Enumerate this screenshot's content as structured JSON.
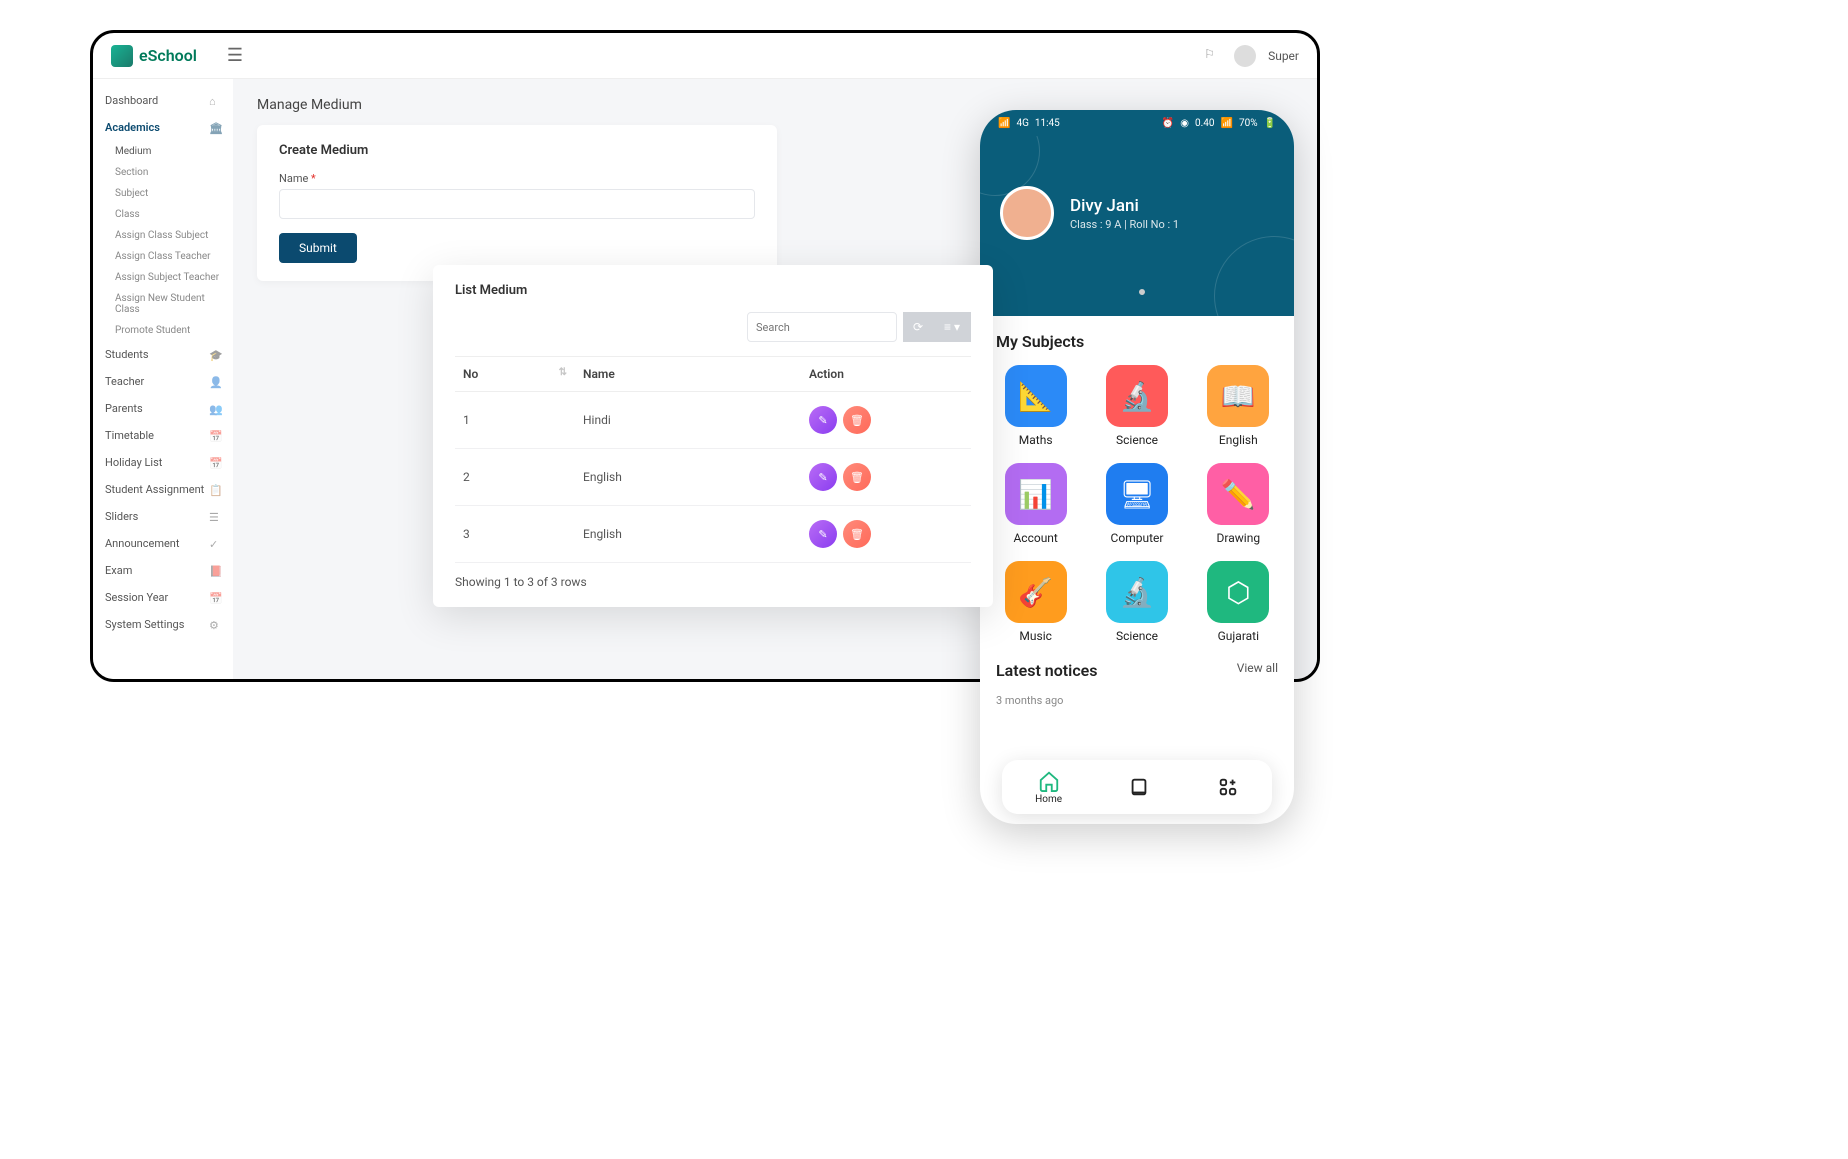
{
  "brand": "eSchool",
  "topbar": {
    "user": "Super"
  },
  "sidebar": {
    "dashboard": "Dashboard",
    "academics": "Academics",
    "academics_sub": [
      "Medium",
      "Section",
      "Subject",
      "Class",
      "Assign Class Subject",
      "Assign Class Teacher",
      "Assign Subject Teacher",
      "Assign New Student Class",
      "Promote Student"
    ],
    "items": [
      "Students",
      "Teacher",
      "Parents",
      "Timetable",
      "Holiday List",
      "Student Assignment",
      "Sliders",
      "Announcement",
      "Exam",
      "Session Year",
      "System Settings"
    ]
  },
  "page": {
    "title": "Manage Medium"
  },
  "create": {
    "title": "Create Medium",
    "name_label": "Name",
    "submit": "Submit"
  },
  "list": {
    "title": "List Medium",
    "search_placeholder": "Search",
    "cols": {
      "no": "No",
      "name": "Name",
      "action": "Action"
    },
    "rows": [
      {
        "no": "1",
        "name": "Hindi"
      },
      {
        "no": "2",
        "name": "English"
      },
      {
        "no": "3",
        "name": "English"
      }
    ],
    "footer": "Showing 1 to 3 of 3 rows"
  },
  "mobile": {
    "status": {
      "time": "11:45",
      "left": "4G",
      "kbps": "0.40",
      "wifi": "70%"
    },
    "profile": {
      "name": "Divy Jani",
      "meta": "Class : 9 A   |   Roll No : 1"
    },
    "subjects_title": "My Subjects",
    "subjects": [
      {
        "label": "Maths",
        "color": "c-blue"
      },
      {
        "label": "Science",
        "color": "c-red"
      },
      {
        "label": "English",
        "color": "c-orange"
      },
      {
        "label": "Account",
        "color": "c-purple"
      },
      {
        "label": "Computer",
        "color": "c-dblue"
      },
      {
        "label": "Drawing",
        "color": "c-pink"
      },
      {
        "label": "Music",
        "color": "c-dorange"
      },
      {
        "label": "Science",
        "color": "c-cyan"
      },
      {
        "label": "Gujarati",
        "color": "c-green"
      }
    ],
    "notices_title": "Latest notices",
    "view_all": "View all",
    "notice_time": "3 months ago",
    "nav": {
      "home": "Home"
    }
  }
}
